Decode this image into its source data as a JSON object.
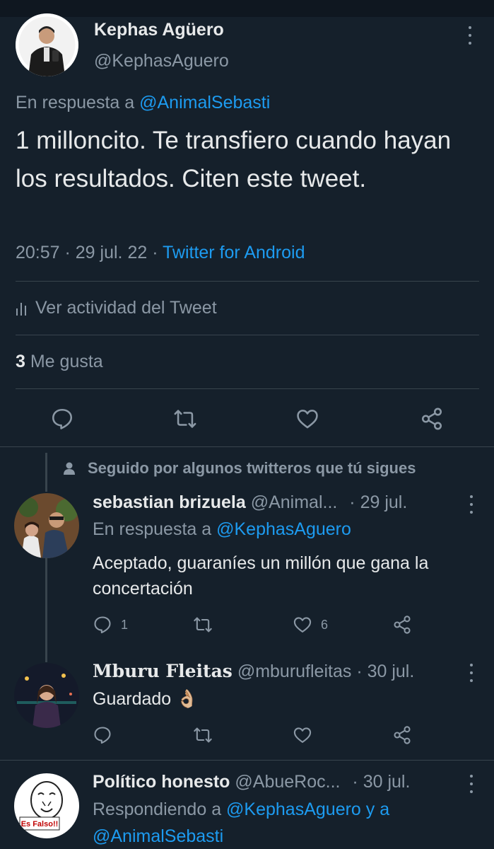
{
  "main_tweet": {
    "author_name": "Kephas Agüero",
    "author_handle": "@KephasAguero",
    "reply_prefix": "En respuesta a ",
    "reply_to": "@AnimalSebasti",
    "text": "1 milloncito. Te transfiero cuando hayan los resultados. Citen este tweet.",
    "time": "20:57",
    "date": "29 jul. 22",
    "source": "Twitter for Android",
    "activity_label": "Ver actividad del Tweet",
    "likes_count": "3",
    "likes_label": "Me gusta"
  },
  "followed_note": "Seguido por algunos twitteros que tú sigues",
  "replies": [
    {
      "name": "sebastian brizuela",
      "handle": "@Animal...",
      "date": "· 29 jul.",
      "reply_prefix": "En respuesta a ",
      "reply_to": "@KephasAguero",
      "text": "Aceptado, guaraníes un millón que gana la concertación",
      "reply_count": "1",
      "like_count": "6"
    },
    {
      "name": "Mburu Fleitas",
      "handle": "@mburufleitas",
      "date": "· 30 jul.",
      "text": "Guardado",
      "emoji": "👌🏼"
    },
    {
      "name": "Político honesto",
      "handle": "@AbueRoc...",
      "date": "· 30 jul.",
      "reply_prefix": "Respondiendo a ",
      "reply_to_1": "@KephasAguero",
      "reply_join": " y a",
      "reply_to_2": "@AnimalSebasti",
      "avatar_text": "Es Falso!!"
    }
  ],
  "colors": {
    "background": "#15202b",
    "link": "#1d9bf0",
    "muted": "#8b98a5",
    "divider": "#38444d"
  }
}
